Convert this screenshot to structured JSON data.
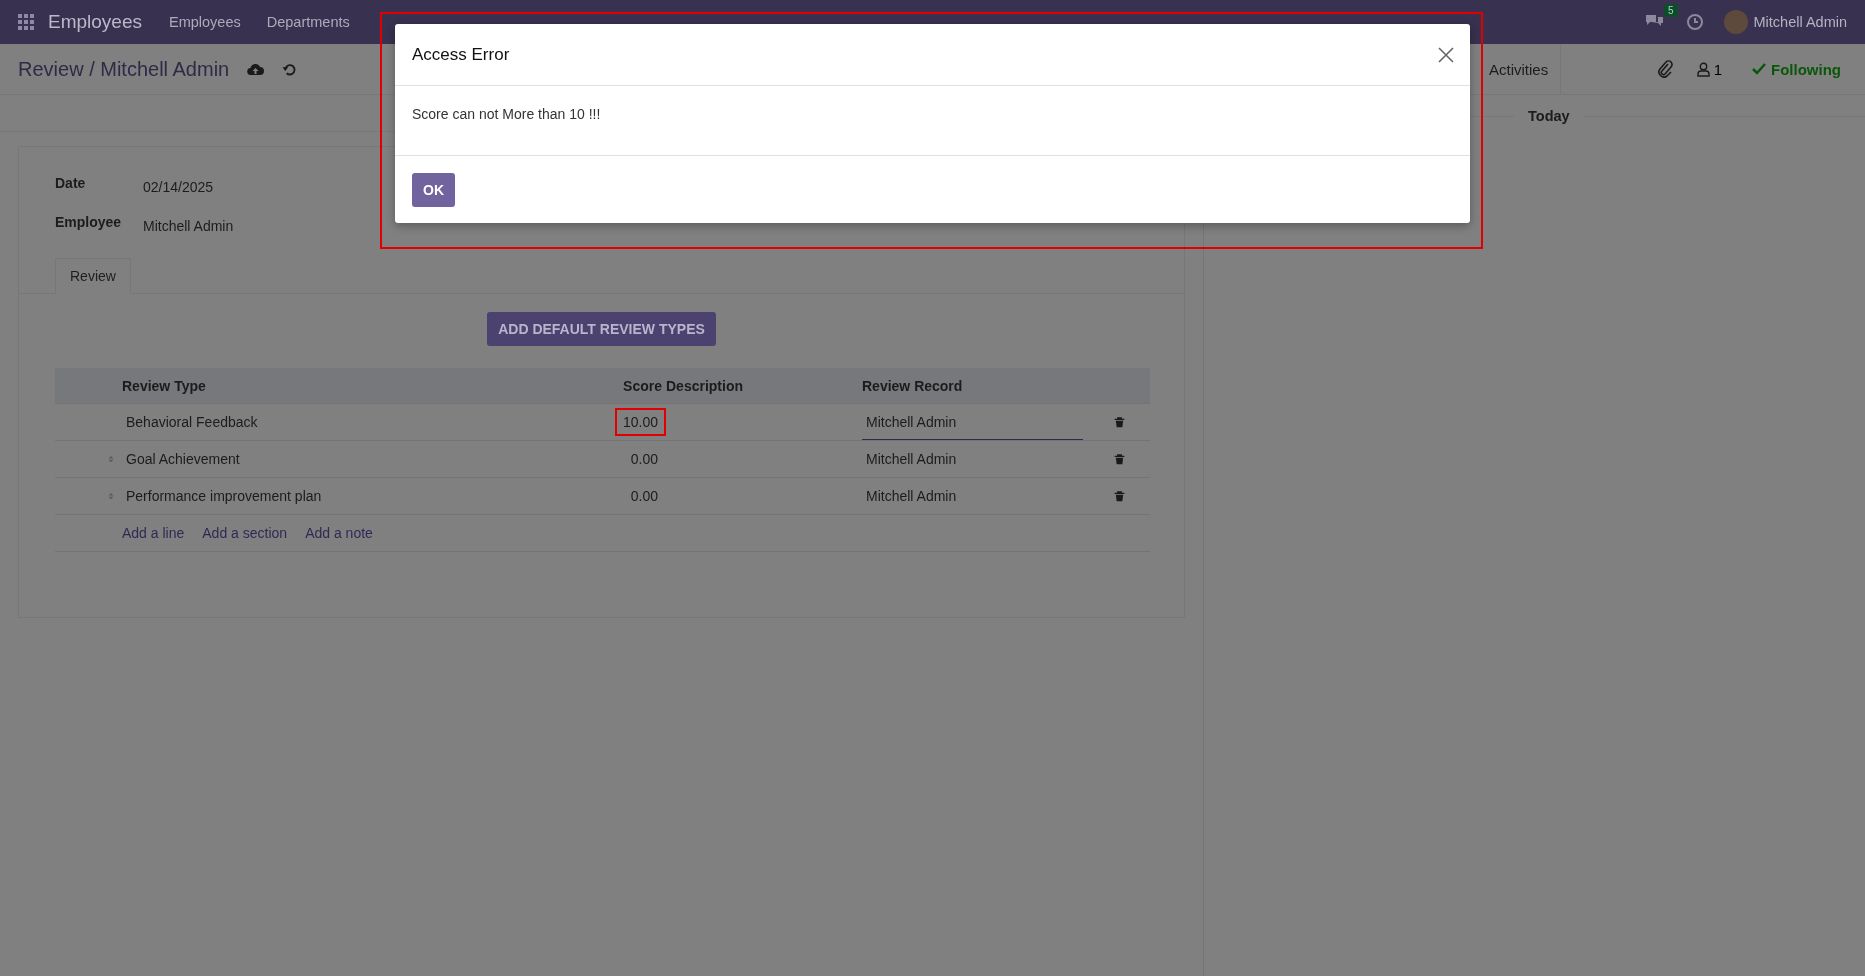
{
  "navbar": {
    "app_name": "Employees",
    "menu": [
      "Employees",
      "Departments"
    ],
    "message_count": "5",
    "user_name": "Mitchell Admin"
  },
  "breadcrumb": {
    "parent": "Review",
    "separator": "/",
    "current": "Mitchell Admin"
  },
  "chatter": {
    "activities_button": "Activities",
    "follower_count": "1",
    "following_label": "Following",
    "date_separator": "Today"
  },
  "form": {
    "fields": [
      {
        "label": "Date",
        "value": "02/14/2025"
      },
      {
        "label": "Employee",
        "value": "Mitchell Admin"
      }
    ],
    "tabs": [
      {
        "label": "Review",
        "selected": true
      }
    ],
    "action_button": "ADD DEFAULT REVIEW TYPES",
    "table": {
      "columns": [
        "Review Type",
        "Score",
        "Description",
        "Review Record"
      ],
      "rows": [
        {
          "review_type": "Behavioral Feedback",
          "score": "10.00",
          "review_record": "Mitchell Admin",
          "editing": true,
          "highlighted": true
        },
        {
          "review_type": "Goal Achievement",
          "score": "0.00",
          "review_record": "Mitchell Admin",
          "editing": false,
          "highlighted": false
        },
        {
          "review_type": "Performance improvement plan",
          "score": "0.00",
          "review_record": "Mitchell Admin",
          "editing": false,
          "highlighted": false
        }
      ],
      "add_links": [
        "Add a line",
        "Add a section",
        "Add a note"
      ]
    }
  },
  "dialog": {
    "title": "Access Error",
    "message": "Score can not More than 10 !!!",
    "button": "OK",
    "highlighted": true
  }
}
